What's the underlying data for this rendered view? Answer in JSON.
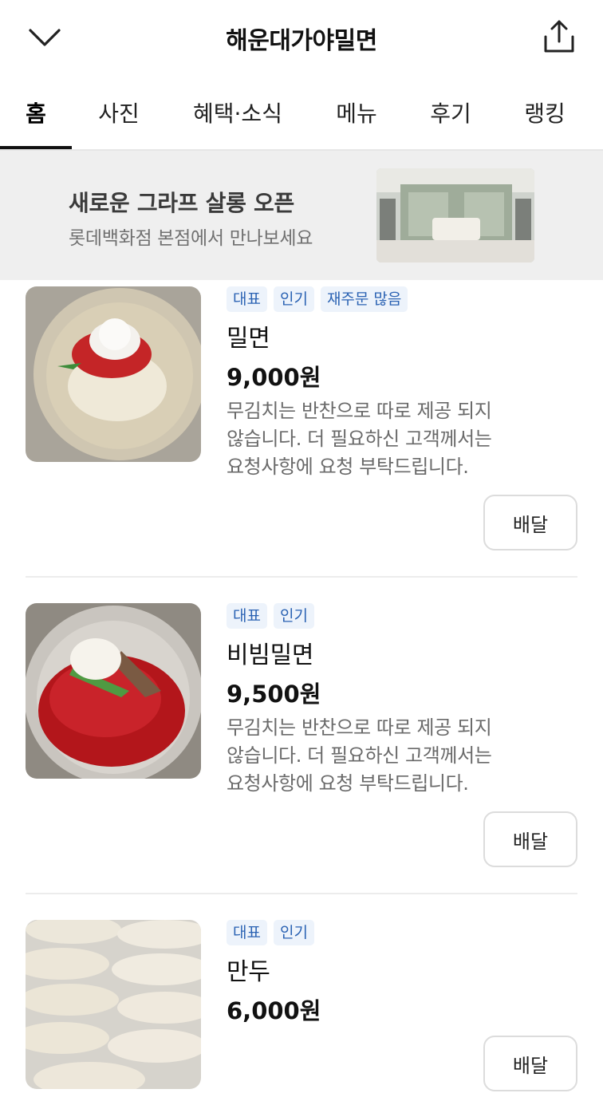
{
  "header": {
    "title": "해운대가야밀면",
    "back_icon": "chevron-down-icon",
    "share_icon": "share-icon"
  },
  "tabs": [
    {
      "label": "홈",
      "active": true
    },
    {
      "label": "사진",
      "active": false
    },
    {
      "label": "혜택·소식",
      "active": false
    },
    {
      "label": "메뉴",
      "active": false
    },
    {
      "label": "후기",
      "active": false
    },
    {
      "label": "랭킹",
      "active": false
    }
  ],
  "banner": {
    "title": "새로운 그라프 살롱 오픈",
    "subtitle": "롯데백화점 본점에서 만나보세요"
  },
  "menu": [
    {
      "badges": [
        "대표",
        "인기",
        "재주문 많음"
      ],
      "name": "밀면",
      "price": "9,000원",
      "desc_lines": [
        "무김치는 반찬으로 따로 제공 되지",
        "않습니다. 더 필요하신 고객께서는",
        "요청사항에 요청 부탁드립니다."
      ],
      "button": "배달"
    },
    {
      "badges": [
        "대표",
        "인기"
      ],
      "name": "비빔밀면",
      "price": "9,500원",
      "desc_lines": [
        "무김치는 반찬으로 따로 제공 되지",
        "않습니다. 더 필요하신 고객께서는",
        "요청사항에 요청 부탁드립니다."
      ],
      "button": "배달"
    },
    {
      "badges": [
        "대표",
        "인기"
      ],
      "name": "만두",
      "price": "6,000원",
      "button": "배달"
    }
  ],
  "colors": {
    "badge_bg": "#edf3fb",
    "badge_text": "#2a62b3",
    "banner_bg": "#efefef"
  }
}
